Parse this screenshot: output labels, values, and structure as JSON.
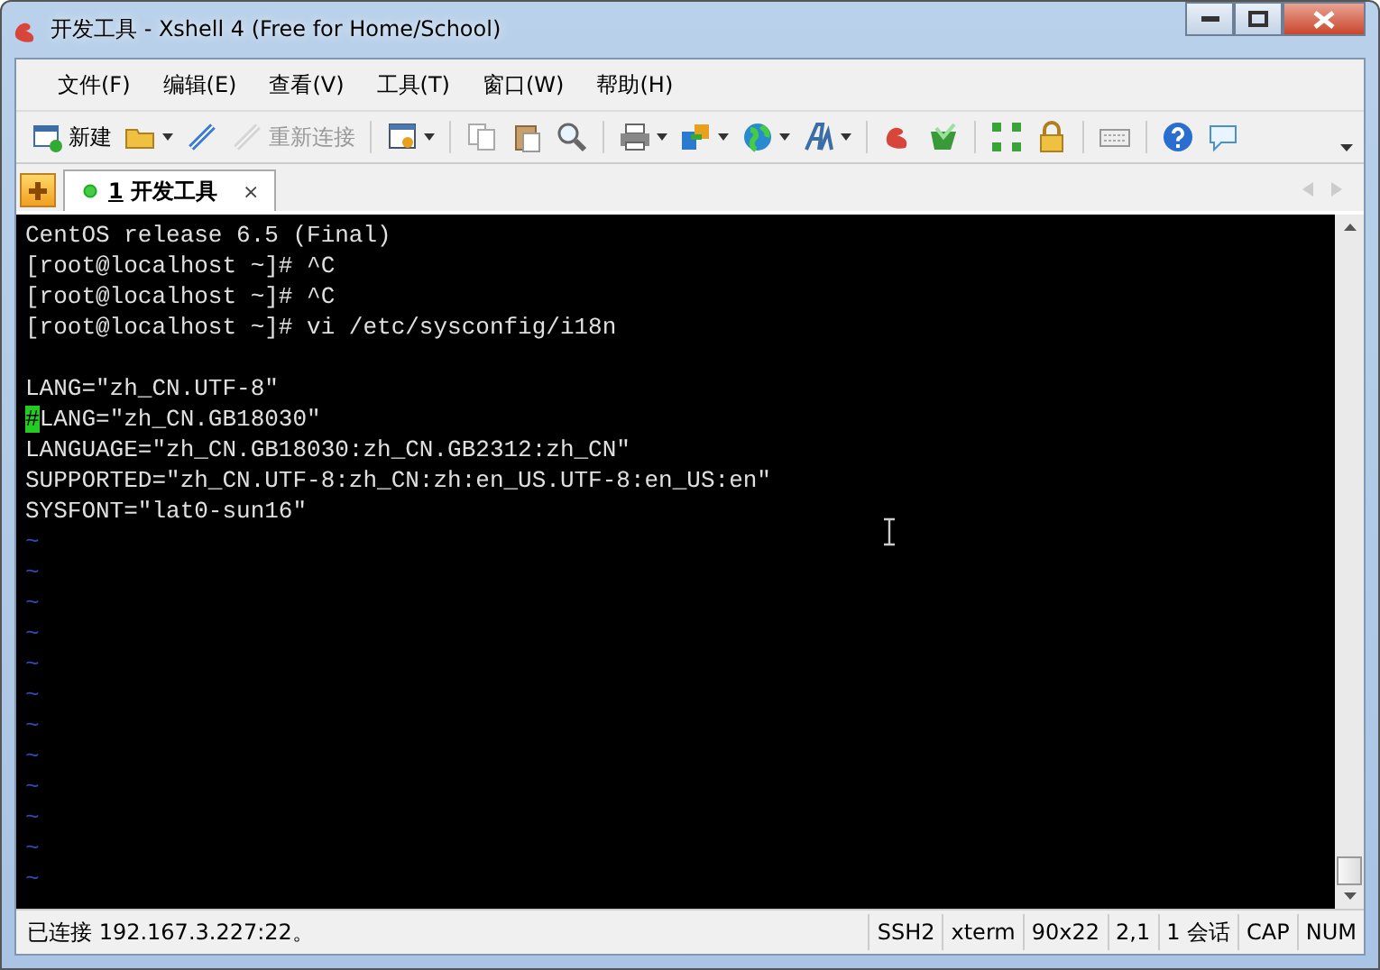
{
  "window": {
    "title": "开发工具 - Xshell 4 (Free for Home/School)"
  },
  "menu": [
    "文件(F)",
    "编辑(E)",
    "查看(V)",
    "工具(T)",
    "窗口(W)",
    "帮助(H)"
  ],
  "toolbar": [
    {
      "kind": "new",
      "label": "新建",
      "disabled": false
    },
    {
      "kind": "open",
      "dropdown": true
    },
    {
      "kind": "connect"
    },
    {
      "kind": "reconnect",
      "label": "重新连接",
      "disabled": true
    },
    {
      "kind": "sep"
    },
    {
      "kind": "props",
      "dropdown": true
    },
    {
      "kind": "sep"
    },
    {
      "kind": "copy"
    },
    {
      "kind": "paste"
    },
    {
      "kind": "find"
    },
    {
      "kind": "sep"
    },
    {
      "kind": "print",
      "dropdown": true
    },
    {
      "kind": "transfer",
      "dropdown": true
    },
    {
      "kind": "globe",
      "dropdown": true
    },
    {
      "kind": "font",
      "dropdown": true
    },
    {
      "kind": "sep"
    },
    {
      "kind": "xshell"
    },
    {
      "kind": "xftp"
    },
    {
      "kind": "sep"
    },
    {
      "kind": "fullscreen"
    },
    {
      "kind": "lock"
    },
    {
      "kind": "sep"
    },
    {
      "kind": "keyboard"
    },
    {
      "kind": "sep"
    },
    {
      "kind": "help"
    },
    {
      "kind": "chat"
    }
  ],
  "tabs": [
    {
      "number": "1",
      "label": "开发工具",
      "selected": true,
      "connected": true,
      "close": "×"
    }
  ],
  "terminal": {
    "lines": [
      {
        "kind": "text",
        "text": "CentOS release 6.5 (Final)"
      },
      {
        "kind": "text",
        "text": "[root@localhost ~]# ^C"
      },
      {
        "kind": "text",
        "text": "[root@localhost ~]# ^C"
      },
      {
        "kind": "text",
        "text": "[root@localhost ~]# vi /etc/sysconfig/i18n"
      },
      {
        "kind": "blank"
      },
      {
        "kind": "text",
        "text": "LANG=\"zh_CN.UTF-8\""
      },
      {
        "kind": "text",
        "text": "#LANG=\"zh_CN.GB18030\"",
        "cursor": true
      },
      {
        "kind": "text",
        "text": "LANGUAGE=\"zh_CN.GB18030:zh_CN.GB2312:zh_CN\""
      },
      {
        "kind": "text",
        "text": "SUPPORTED=\"zh_CN.UTF-8:zh_CN:zh:en_US.UTF-8:en_US:en\""
      },
      {
        "kind": "text",
        "text": "SYSFONT=\"lat0-sun16\""
      },
      {
        "kind": "text",
        "text": "~",
        "dim": true
      },
      {
        "kind": "text",
        "text": "~",
        "dim": true
      },
      {
        "kind": "text",
        "text": "~",
        "dim": true
      },
      {
        "kind": "text",
        "text": "~",
        "dim": true
      },
      {
        "kind": "text",
        "text": "~",
        "dim": true
      },
      {
        "kind": "text",
        "text": "~",
        "dim": true
      },
      {
        "kind": "text",
        "text": "~",
        "dim": true
      },
      {
        "kind": "text",
        "text": "~",
        "dim": true
      },
      {
        "kind": "text",
        "text": "~",
        "dim": true
      },
      {
        "kind": "text",
        "text": "~",
        "dim": true
      },
      {
        "kind": "text",
        "text": "~",
        "dim": true
      },
      {
        "kind": "text",
        "text": "~",
        "dim": true
      }
    ]
  },
  "status_bar": {
    "message": "已连接 192.167.3.227:22。",
    "fields": [
      "SSH2",
      "xterm",
      "90x22",
      "2,1",
      "1 会话",
      "CAP",
      "NUM"
    ]
  }
}
